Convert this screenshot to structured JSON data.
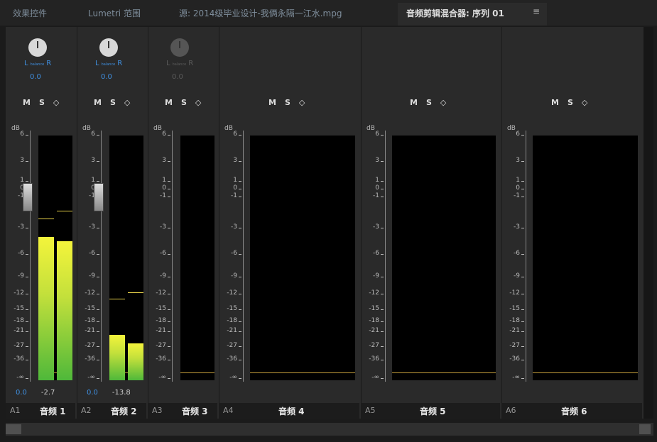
{
  "tabs": [
    {
      "label": "效果控件"
    },
    {
      "label": "Lumetri 范围"
    },
    {
      "label": "源: 2014级毕业设计-我俩永隔一江水.mpg"
    },
    {
      "label": "音频剪辑混合器: 序列 01"
    }
  ],
  "tab_menu_icon": "≡",
  "scale": {
    "unit": "dB",
    "ticks": [
      "6",
      "3",
      "1",
      "0",
      "-1",
      "-3",
      "-6",
      "-9",
      "-12",
      "-15",
      "-18",
      "-21",
      "-27",
      "-36",
      "-∞"
    ]
  },
  "msd": [
    "M",
    "S",
    "◇"
  ],
  "pan": {
    "l": "L",
    "r": "R",
    "mid": "balance"
  },
  "channels": [
    {
      "id": "A1",
      "name": "音频 1",
      "pan_value": "0.0",
      "volume": "0.0",
      "peak": "-2.7",
      "level_l_db": -4.5,
      "level_r_db": -5.0,
      "peak_l_db": -2.7,
      "peak_r_db": -2.2,
      "active": true
    },
    {
      "id": "A2",
      "name": "音频 2",
      "pan_value": "0.0",
      "volume": "0.0",
      "peak": "-13.8",
      "level_l_db": -24.0,
      "level_r_db": -28.0,
      "peak_l_db": -13.8,
      "peak_r_db": -12.5,
      "active": true
    },
    {
      "id": "A3",
      "name": "音频 3",
      "pan_value": "0.0",
      "volume": "",
      "peak": "",
      "active": false
    },
    {
      "id": "A4",
      "name": "音频 4",
      "pan_value": "",
      "volume": "",
      "peak": "",
      "active": false
    },
    {
      "id": "A5",
      "name": "音频 5",
      "pan_value": "",
      "volume": "",
      "peak": "",
      "active": false
    },
    {
      "id": "A6",
      "name": "音频 6",
      "pan_value": "",
      "volume": "",
      "peak": "",
      "active": false
    }
  ],
  "colors": {
    "meter_low": "#4fb83a",
    "meter_high": "#f4f43b",
    "accent": "#3f8fe0"
  }
}
